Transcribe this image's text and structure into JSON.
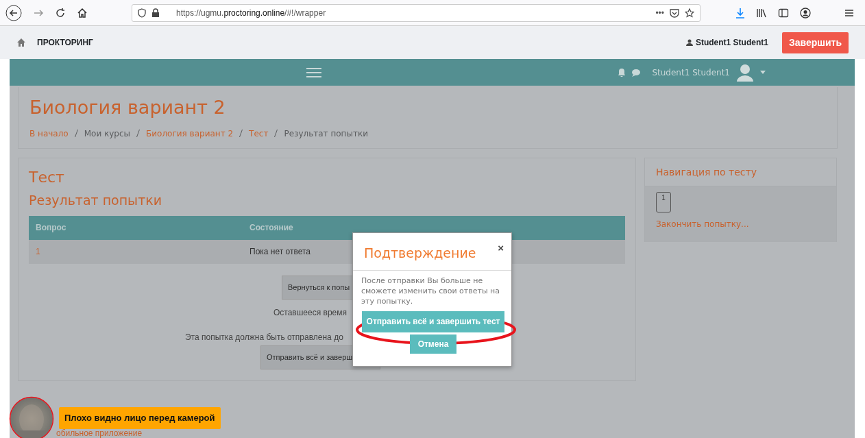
{
  "browser": {
    "url": "https://ugmu.**proctoring.online**/#!/wrapper",
    "menu_dots": "•••"
  },
  "app_header": {
    "brand": "ПРОКТОРИНГ",
    "user": "Student1 Student1",
    "finish_button": "Завершить"
  },
  "navbar": {
    "user": "Student1 Student1"
  },
  "page_header": {
    "title": "Биология вариант 2",
    "breadcrumbs": [
      {
        "label": "В начало",
        "link": true
      },
      {
        "label": "Мои курсы",
        "link": false
      },
      {
        "label": "Биология вариант 2",
        "link": true
      },
      {
        "label": "Тест",
        "link": true
      },
      {
        "label": "Результат попытки",
        "link": false
      }
    ]
  },
  "quiz": {
    "title": "Тест",
    "subtitle": "Результат попытки",
    "table": {
      "columns": [
        "Вопрос",
        "Состояние"
      ],
      "rows": [
        [
          "1",
          "Пока нет ответа"
        ]
      ]
    },
    "return_button": "Вернуться к попы",
    "time_text": "Оставшееся время",
    "deadline_text": "Эта попытка должна быть отправлена до",
    "submit_button": "Отправить всё и заверш"
  },
  "navigation": {
    "title": "Навигация по тесту",
    "questions": [
      {
        "label": "1"
      }
    ],
    "finish_link": "Закончить попытку..."
  },
  "modal": {
    "title": "Подтверждение",
    "close": "×",
    "message": "После отправки Вы больше не сможете изменить свои ответы на эту попытку.",
    "submit_button": "Отправить всё и завершить тест",
    "cancel_button": "Отмена"
  },
  "camera": {
    "alert": "Плохо видно лицо перед камерой"
  },
  "footer_link": "обильное приложение"
}
